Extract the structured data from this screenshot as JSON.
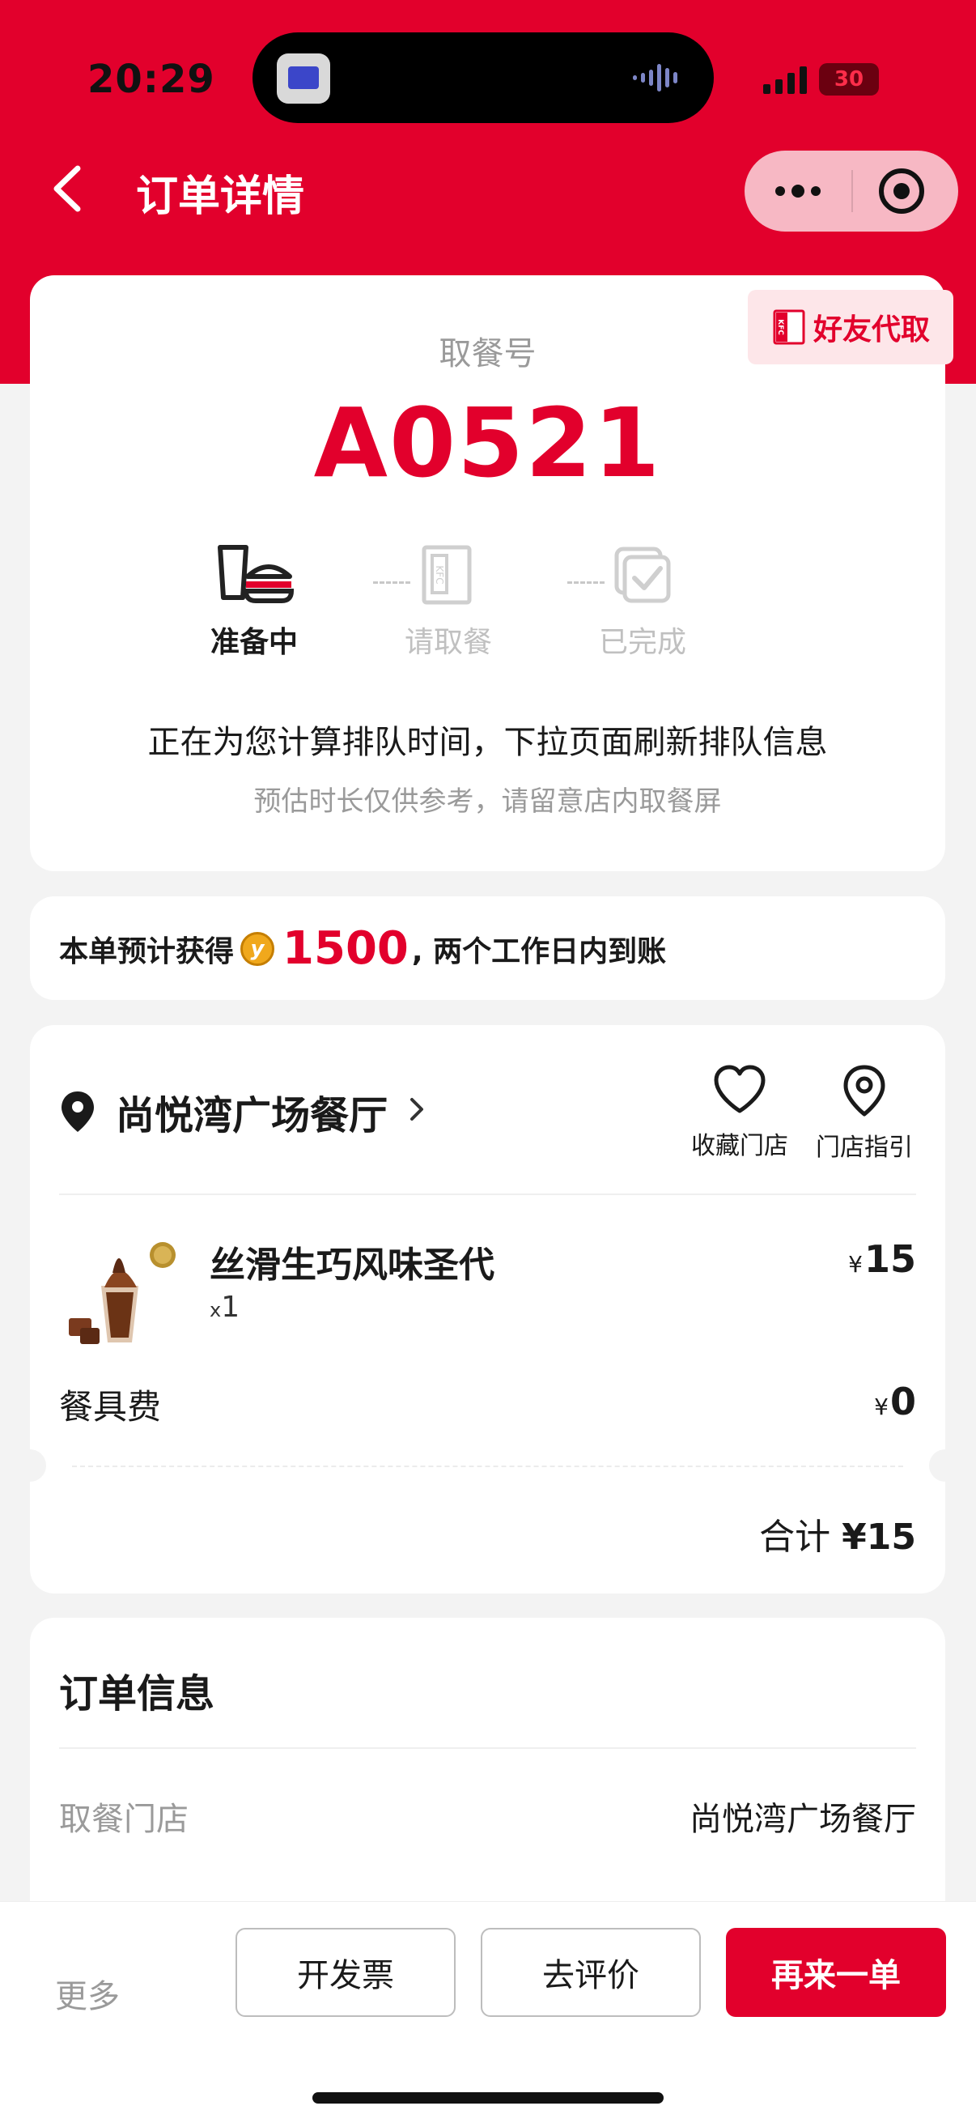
{
  "status_bar": {
    "time": "20:29",
    "battery": "30"
  },
  "nav": {
    "title": "订单详情"
  },
  "pickup": {
    "friend_tag": "好友代取",
    "label": "取餐号",
    "number": "A0521",
    "steps": [
      {
        "label": "准备中",
        "active": true
      },
      {
        "label": "请取餐",
        "active": false
      },
      {
        "label": "已完成",
        "active": false
      }
    ],
    "queue_main": "正在为您计算排队时间，下拉页面刷新排队信息",
    "queue_sub": "预估时长仅供参考，请留意店内取餐屏"
  },
  "points": {
    "prefix": "本单预计获得",
    "coin_symbol": "y",
    "value": "1500",
    "suffix": ", 两个工作日内到账"
  },
  "order": {
    "store_name": "尚悦湾广场餐厅",
    "actions": [
      {
        "label": "收藏门店",
        "icon": "heart-icon"
      },
      {
        "label": "门店指引",
        "icon": "location-pin-icon"
      }
    ],
    "item": {
      "name": "丝滑生巧风味圣代",
      "qty_prefix": "x",
      "qty": "1",
      "currency": "¥",
      "price": "15"
    },
    "fee": {
      "label": "餐具费",
      "currency": "¥",
      "price": "0"
    },
    "total": {
      "label": "合计",
      "value": "¥15"
    }
  },
  "info": {
    "title": "订单信息",
    "rows": [
      {
        "label": "取餐门店",
        "value": "尚悦湾广场餐厅"
      }
    ]
  },
  "bottom": {
    "more": "更多",
    "invoice": "开发票",
    "review": "去评价",
    "reorder": "再来一单"
  },
  "colors": {
    "brand_red": "#e2002c",
    "background": "#f3f3f3"
  }
}
